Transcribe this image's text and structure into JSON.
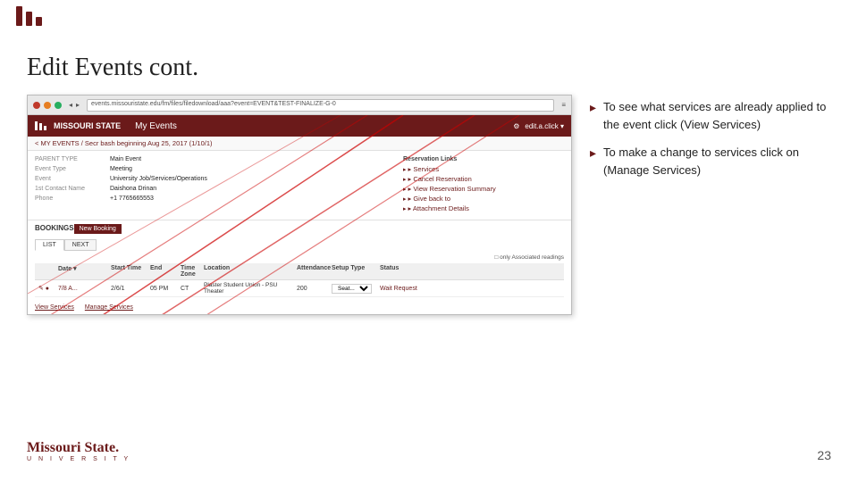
{
  "topbar": {
    "logo": "three-bars"
  },
  "title": "Edit Events cont.",
  "browser": {
    "address": "events.missouristate.edu/fm/files/filedownload/aaa?event=EVENT&TEST-FINALIZE-G-0"
  },
  "app_header": {
    "brand": "MISSOURI STATE",
    "title": "My Events",
    "user": "edit.a.click ▾"
  },
  "breadcrumb": "< MY EVENTS / Secr bash beginning Aug 25, 2017 (1/10/1)",
  "event_fields": [
    {
      "label": "PARENT TYPE",
      "value": "Main Event"
    },
    {
      "label": "Event Type",
      "value": "Meeting"
    },
    {
      "label": "Event",
      "value": "University Job/Services/Operations"
    },
    {
      "label": "1st Contact Name",
      "value": "Daishona Drinan"
    },
    {
      "label": "Phone",
      "value": "+1 7765665553"
    }
  ],
  "reservation_links": [
    "Services",
    "Cancel Reservation",
    "View Reservation Summary",
    "Give back to",
    "Attachment Details"
  ],
  "bookings_header": "BOOKINGS",
  "tabs": [
    {
      "label": "LIST",
      "active": true
    },
    {
      "label": "NEXT",
      "active": false
    }
  ],
  "new_booking_btn": "New Booking",
  "table_headers": [
    "",
    "Date ▾",
    "Start Time",
    "End",
    "Time Zone",
    "Location",
    "Attendance",
    "Setup Type",
    "Status"
  ],
  "table_rows": [
    {
      "icons": "✎ ●",
      "date": "7/8 A...",
      "start": "2/6/1",
      "end": "05 PM",
      "tz": "CT",
      "location": "Plaster Student Union - PSU Theater",
      "attendance": "200",
      "setup": "Seat...",
      "status": "Wait Request"
    }
  ],
  "bottom_links": [
    "View Services",
    "Manage Services"
  ],
  "bullets": [
    {
      "text": "To see what services are already applied to the event click (View Services)"
    },
    {
      "text": "To make a change to services click on (Manage Services)"
    }
  ],
  "msu_wordmark": "Missouri State.",
  "msu_sub": "U N I V E R S I T Y",
  "page_number": "23"
}
